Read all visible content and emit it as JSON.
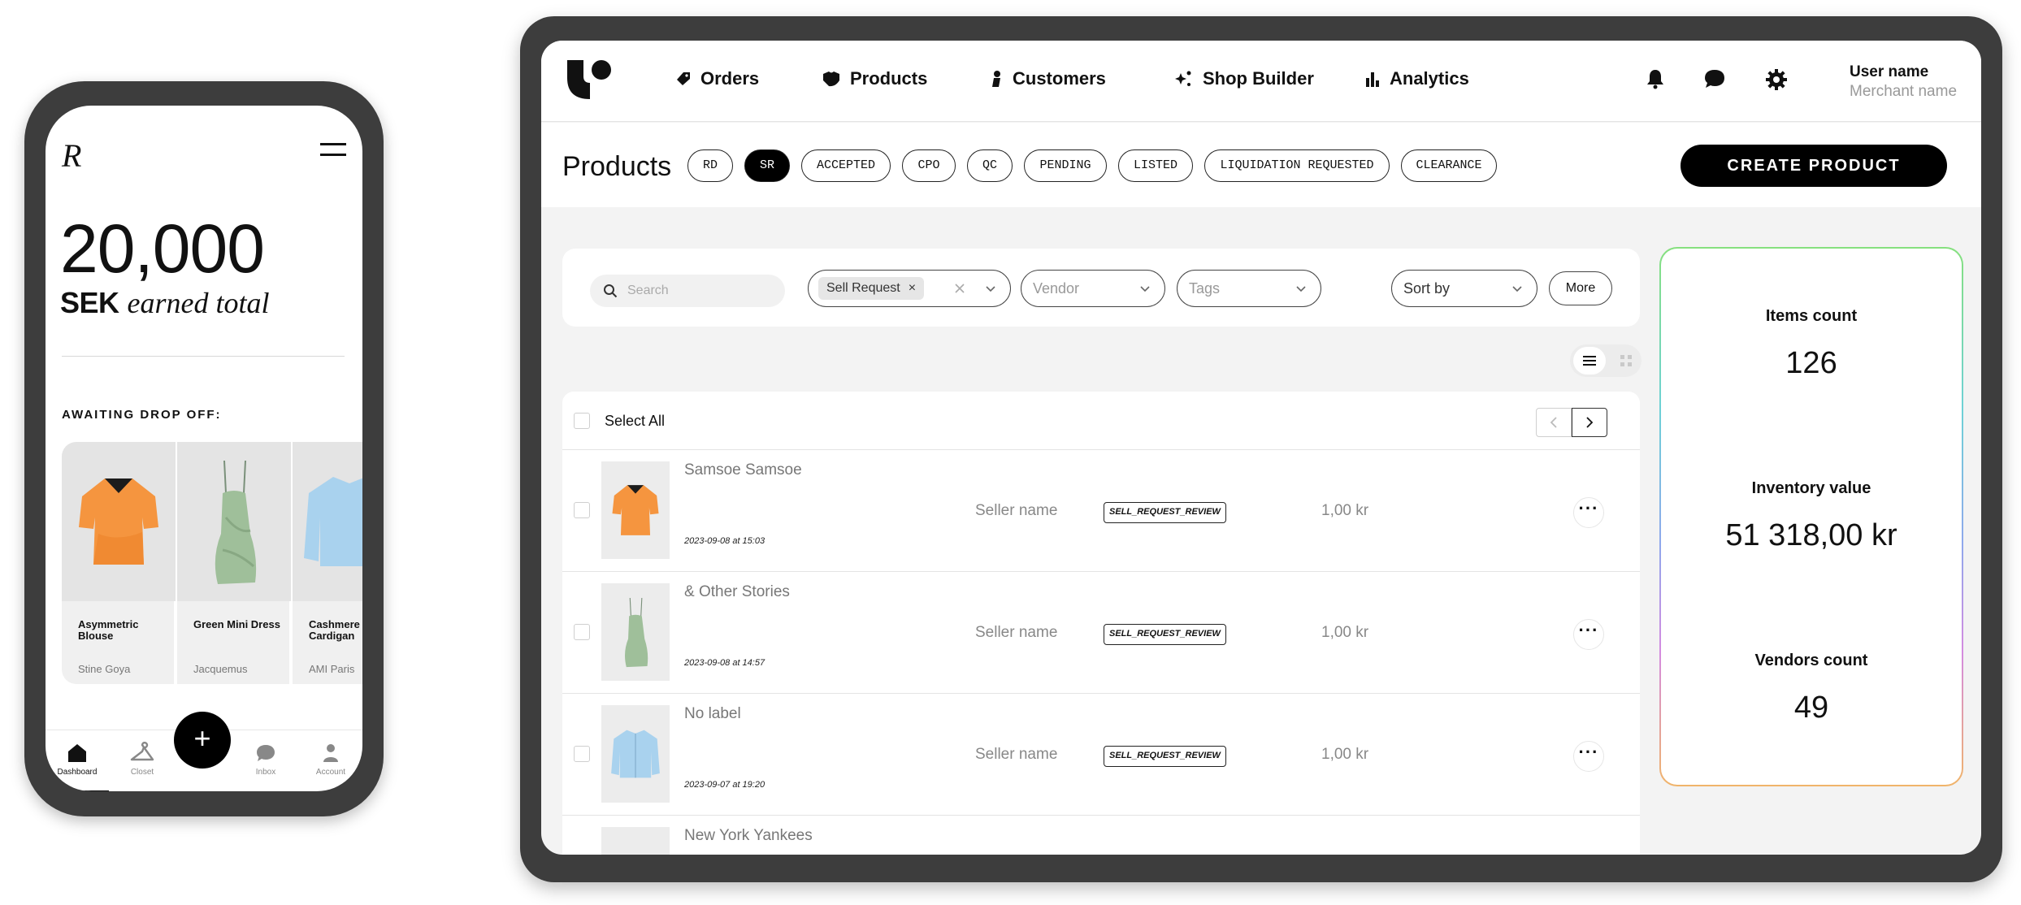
{
  "phone": {
    "logo": "R",
    "amount": "20,000",
    "currency": "SEK",
    "earned_label": "earned total",
    "section_title": "AWAITING DROP OFF:",
    "items": [
      {
        "name": "Asymmetric Blouse",
        "brand": "Stine Goya",
        "color": "#f5953f"
      },
      {
        "name": "Green Mini Dress",
        "brand": "Jacquemus",
        "color": "#9fbf9a"
      },
      {
        "name": "Cashmere Cardigan",
        "brand": "AMI Paris",
        "color": "#a9d2ee"
      }
    ],
    "tabs": [
      {
        "label": "Dashboard",
        "icon": "home-icon"
      },
      {
        "label": "Closet",
        "icon": "hanger-icon"
      },
      {
        "label": "Inbox",
        "icon": "chat-icon"
      },
      {
        "label": "Account",
        "icon": "person-icon"
      }
    ],
    "fab_label": "+"
  },
  "tablet": {
    "nav": {
      "items": [
        {
          "label": "Orders",
          "icon": "tag-icon"
        },
        {
          "label": "Products",
          "icon": "shirt-icon"
        },
        {
          "label": "Customers",
          "icon": "person-icon"
        },
        {
          "label": "Shop Builder",
          "icon": "sparkle-icon"
        },
        {
          "label": "Analytics",
          "icon": "bar-chart-icon"
        }
      ],
      "user_name": "User name",
      "merchant_name": "Merchant name"
    },
    "page_title": "Products",
    "status_chips": [
      "RD",
      "SR",
      "ACCEPTED",
      "CPO",
      "QC",
      "PENDING",
      "LISTED",
      "LIQUIDATION REQUESTED",
      "CLEARANCE"
    ],
    "selected_chip": "SR",
    "create_button": "CREATE PRODUCT",
    "filters": {
      "search_placeholder": "Search",
      "active_tag": "Sell Request",
      "vendor_placeholder": "Vendor",
      "tags_placeholder": "Tags",
      "sort_label": "Sort by",
      "more_label": "More"
    },
    "table": {
      "select_all": "Select All",
      "rows": [
        {
          "title": "Samsoe Samsoe",
          "date": "2023-09-08 at 15:03",
          "seller": "Seller name",
          "status": "SELL_REQUEST_REVIEW",
          "price": "1,00 kr"
        },
        {
          "title": "& Other Stories",
          "date": "2023-09-08 at 14:57",
          "seller": "Seller name",
          "status": "SELL_REQUEST_REVIEW",
          "price": "1,00 kr"
        },
        {
          "title": "No label",
          "date": "2023-09-07 at 19:20",
          "seller": "Seller name",
          "status": "SELL_REQUEST_REVIEW",
          "price": "1,00 kr"
        },
        {
          "title": "New York Yankees",
          "date": "",
          "seller": "",
          "status": "",
          "price": ""
        }
      ]
    },
    "stats": [
      {
        "label": "Items count",
        "value": "126"
      },
      {
        "label": "Inventory value",
        "value": "51 318,00 kr"
      },
      {
        "label": "Vendors count",
        "value": "49"
      }
    ]
  }
}
